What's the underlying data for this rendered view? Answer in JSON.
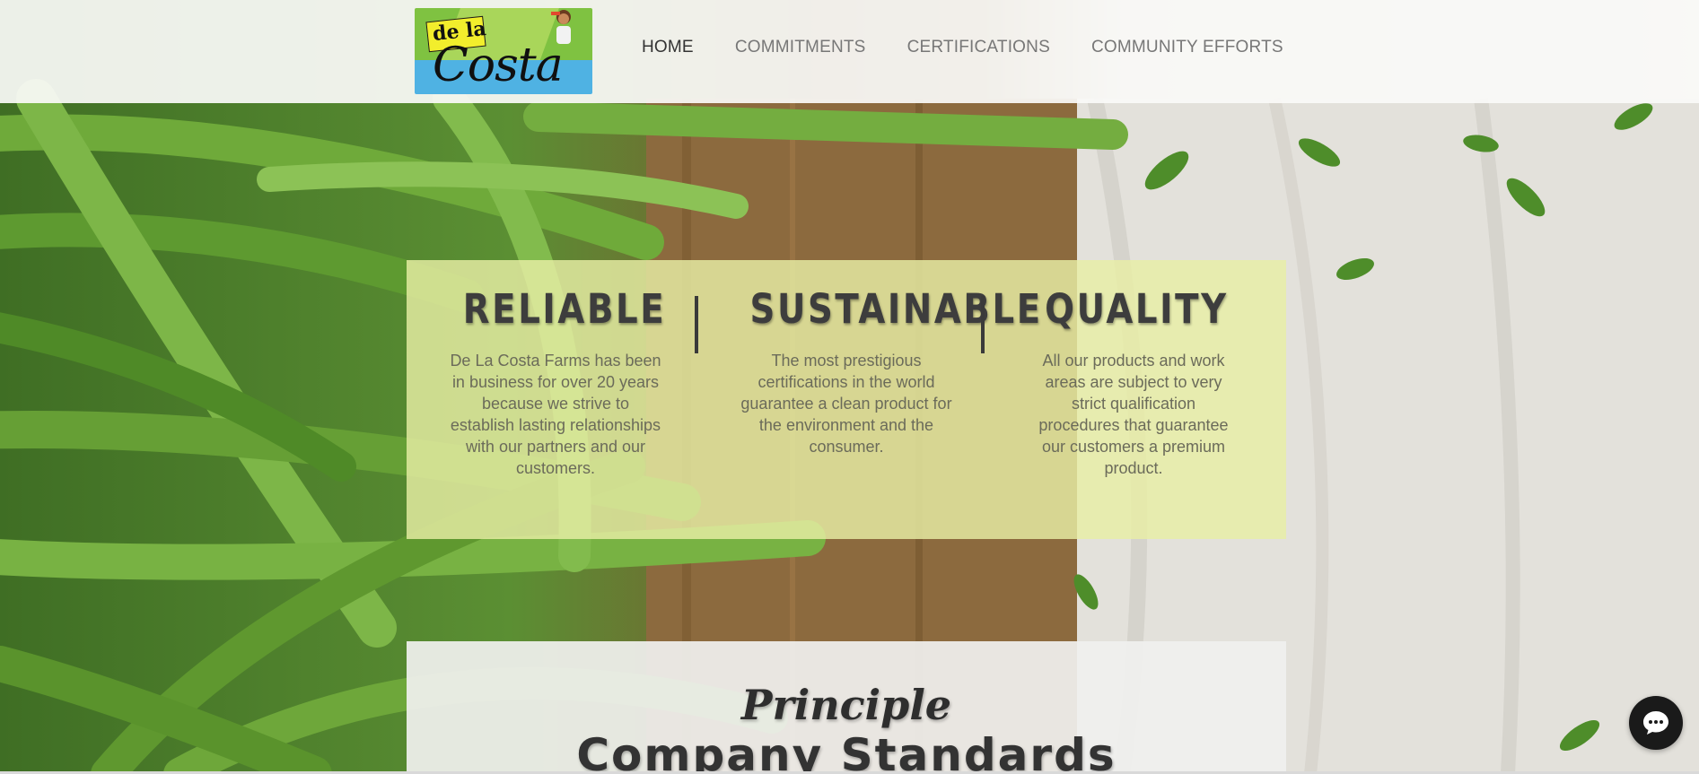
{
  "header": {
    "logo": {
      "line1": "de la",
      "line2": "Costa"
    },
    "nav": [
      {
        "label": "HOME",
        "active": true
      },
      {
        "label": "COMMITMENTS",
        "active": false
      },
      {
        "label": "CERTIFICATIONS",
        "active": false
      },
      {
        "label": "COMMUNITY EFFORTS",
        "active": false
      }
    ]
  },
  "values": [
    {
      "title": "RELIABLE",
      "text": "De La Costa Farms has been in business for over 20 years because we strive to establish lasting relationships with our partners and our customers."
    },
    {
      "title": "SUSTAINABLE",
      "text": "The most prestigious certifications in the world guarantee a clean product for the environment and the consumer."
    },
    {
      "title": "QUALITY",
      "text": "All our products and work areas are subject to very strict qualification procedures that guarantee our customers a premium product."
    }
  ],
  "standards": {
    "script_title": "Principle",
    "title": "Company Standards"
  },
  "chat": {
    "icon": "chat-bubble-icon"
  },
  "colors": {
    "panel": "#e8eea5",
    "nav_text": "#777777",
    "nav_active": "#333333",
    "heading": "#3d3d3d",
    "body_text": "#6b6b5a"
  }
}
